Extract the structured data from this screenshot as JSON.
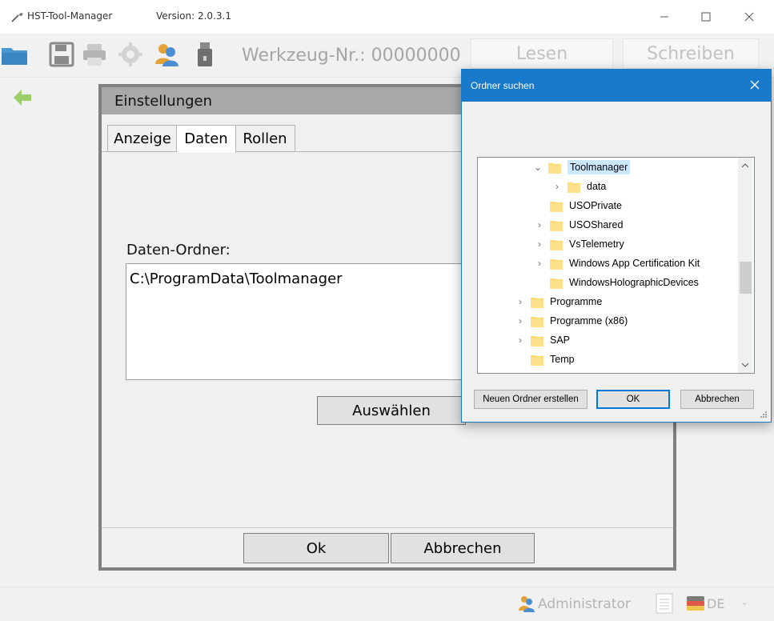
{
  "window": {
    "app_title": "HST-Tool-Manager",
    "version": "Version: 2.0.3.1",
    "controls": {
      "minimize": "—",
      "maximize": "☐",
      "close": "✕"
    }
  },
  "toolbar": {
    "icons": [
      "folder-icon",
      "save-icon",
      "print-icon",
      "gear-icon",
      "user-icon",
      "usb-stick-icon"
    ],
    "tool_number": "Werkzeug-Nr.: 00000000",
    "read_label": "Lesen",
    "write_label": "Schreiben"
  },
  "nav": {
    "back_icon": "back-arrow-icon"
  },
  "settings_dialog": {
    "title": "Einstellungen",
    "tabs": [
      {
        "label": "Anzeige",
        "active": false
      },
      {
        "label": "Daten",
        "active": true
      },
      {
        "label": "Rollen",
        "active": false
      }
    ],
    "data_folder_label": "Daten-Ordner:",
    "data_folder_value": "C:\\ProgramData\\Toolmanager",
    "select_label": "Auswählen",
    "ok_label": "Ok",
    "cancel_label": "Abbrechen"
  },
  "status_bar": {
    "user_label": "Administrator",
    "language": "DE"
  },
  "folder_browser": {
    "title": "Ordner suchen",
    "tree": [
      {
        "label": "Toolmanager",
        "expanded": true,
        "selected": true
      },
      {
        "label": "data",
        "expandable": true
      },
      {
        "label": "USOPrivate",
        "expandable": false
      },
      {
        "label": "USOShared",
        "expandable": true
      },
      {
        "label": "VsTelemetry",
        "expandable": true
      },
      {
        "label": "Windows App Certification Kit",
        "expandable": true
      },
      {
        "label": "WindowsHolographicDevices",
        "expandable": false
      },
      {
        "label": "Programme",
        "expandable": true
      },
      {
        "label": "Programme (x86)",
        "expandable": true
      },
      {
        "label": "SAP",
        "expandable": true
      },
      {
        "label": "Temp",
        "expandable": false
      }
    ],
    "new_folder_label": "Neuen Ordner erstellen",
    "ok_label": "OK",
    "cancel_label": "Abbrechen"
  },
  "colors": {
    "accent": "#1979ca",
    "selection": "#cce8ff",
    "folder": "#ffd867",
    "dialog_header": "#a9a9a9"
  }
}
